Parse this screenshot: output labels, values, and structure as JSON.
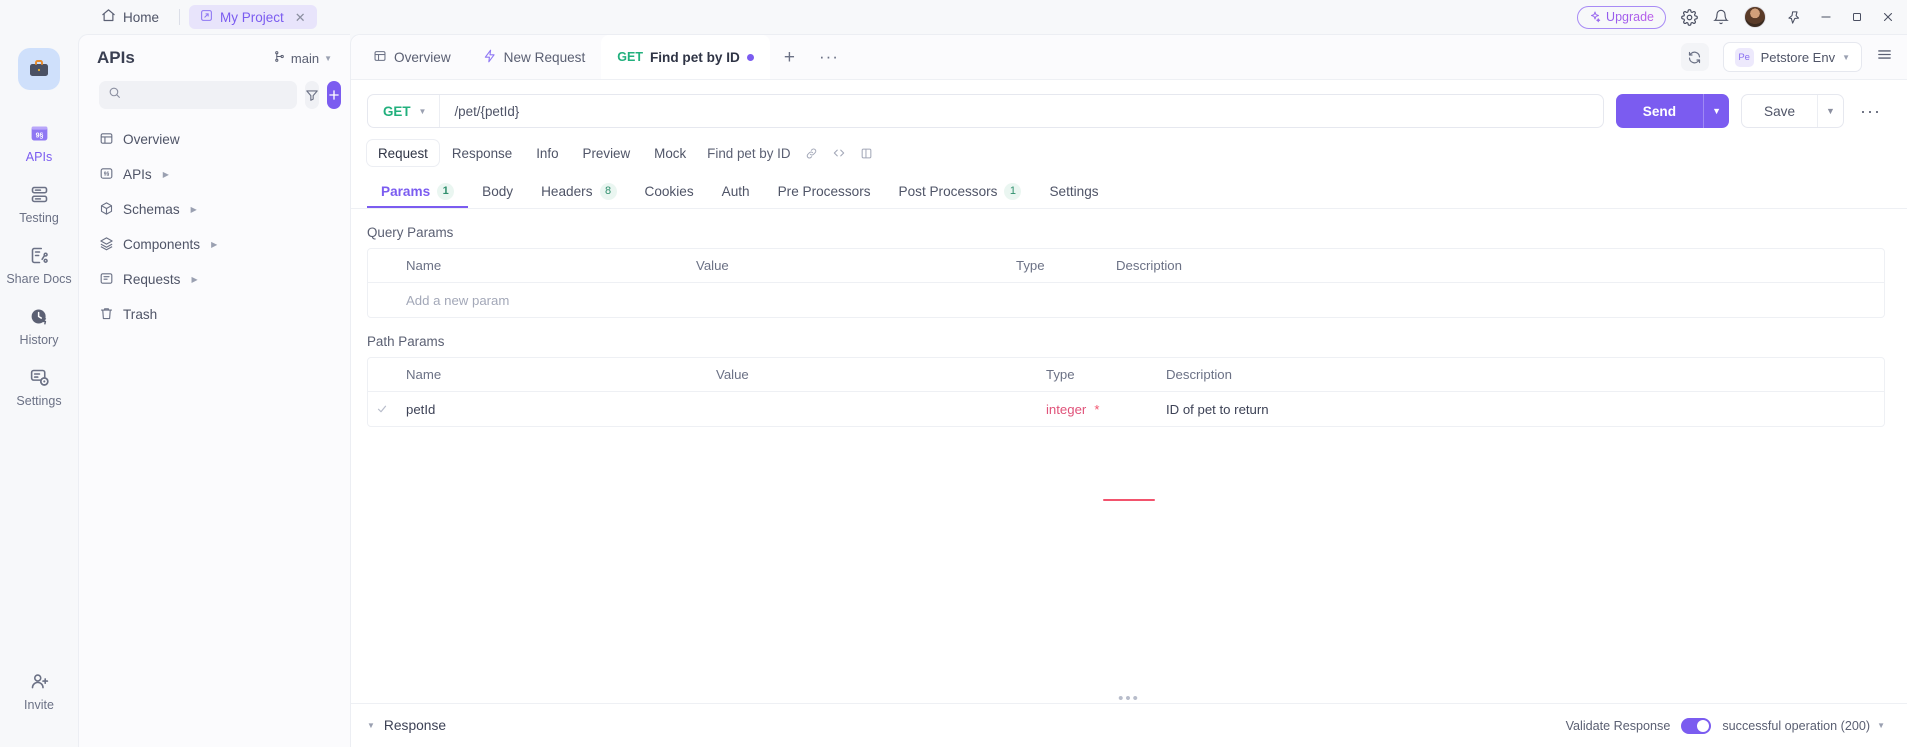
{
  "titlebar": {
    "home_label": "Home",
    "project_tab": "My Project",
    "close_label": "✕",
    "upgrade_label": "Upgrade"
  },
  "rail": {
    "items": [
      {
        "label": "APIs",
        "icon": "apis-icon",
        "active": true
      },
      {
        "label": "Testing",
        "icon": "testing-icon",
        "active": false
      },
      {
        "label": "Share Docs",
        "icon": "share-docs-icon",
        "active": false
      },
      {
        "label": "History",
        "icon": "history-icon",
        "active": false
      },
      {
        "label": "Settings",
        "icon": "settings-icon",
        "active": false
      }
    ],
    "invite_label": "Invite"
  },
  "sidebar": {
    "title": "APIs",
    "branch": "main",
    "search_placeholder": "",
    "tree": [
      {
        "label": "Overview",
        "icon": "overview-icon",
        "expandable": false
      },
      {
        "label": "APIs",
        "icon": "apis-tree-icon",
        "expandable": true
      },
      {
        "label": "Schemas",
        "icon": "schemas-icon",
        "expandable": true
      },
      {
        "label": "Components",
        "icon": "components-icon",
        "expandable": true
      },
      {
        "label": "Requests",
        "icon": "requests-icon",
        "expandable": true
      },
      {
        "label": "Trash",
        "icon": "trash-icon",
        "expandable": false
      }
    ]
  },
  "tabbar": {
    "tabs": [
      {
        "label": "Overview",
        "icon": "overview-icon",
        "selected": false
      },
      {
        "label": "New Request",
        "icon": "new-request-icon",
        "selected": false
      },
      {
        "label": "Find pet by ID",
        "verb": "GET",
        "selected": true,
        "unsaved": true
      }
    ],
    "add_label": "+",
    "overflow_label": "···",
    "env_name": "Petstore Env",
    "env_badge": "Pe"
  },
  "url": {
    "method": "GET",
    "path": "/pet/{petId}",
    "send_label": "Send",
    "save_label": "Save",
    "more_label": "···"
  },
  "subtabs": {
    "items": [
      {
        "label": "Request",
        "selected": true
      },
      {
        "label": "Response",
        "selected": false
      },
      {
        "label": "Info",
        "selected": false
      },
      {
        "label": "Preview",
        "selected": false
      },
      {
        "label": "Mock",
        "selected": false
      }
    ],
    "request_name": "Find pet by ID"
  },
  "param_tabs": [
    {
      "label": "Params",
      "count": "1",
      "selected": true
    },
    {
      "label": "Body",
      "count": "",
      "selected": false
    },
    {
      "label": "Headers",
      "count": "8",
      "selected": false
    },
    {
      "label": "Cookies",
      "count": "",
      "selected": false
    },
    {
      "label": "Auth",
      "count": "",
      "selected": false
    },
    {
      "label": "Pre Processors",
      "count": "",
      "selected": false
    },
    {
      "label": "Post Processors",
      "count": "1",
      "selected": false
    },
    {
      "label": "Settings",
      "count": "",
      "selected": false
    }
  ],
  "query_params": {
    "title": "Query Params",
    "columns": [
      "Name",
      "Value",
      "Type",
      "Description"
    ],
    "empty_row": "Add a new param",
    "rows": []
  },
  "path_params": {
    "title": "Path Params",
    "columns": [
      "Name",
      "Value",
      "Type",
      "Description"
    ],
    "rows": [
      {
        "checked": true,
        "name": "petId",
        "value": "",
        "type": "integer",
        "required": "*",
        "description": "ID of pet to return"
      }
    ]
  },
  "response": {
    "title": "Response",
    "validate_label": "Validate Response",
    "validate_on": true,
    "selected_status": "successful operation (200)"
  },
  "colors": {
    "accent": "#7b5cf0",
    "verb_get": "#22b07d",
    "required": "#f2536d",
    "type_integer": "#e0537a",
    "loader": "#f2536d"
  }
}
